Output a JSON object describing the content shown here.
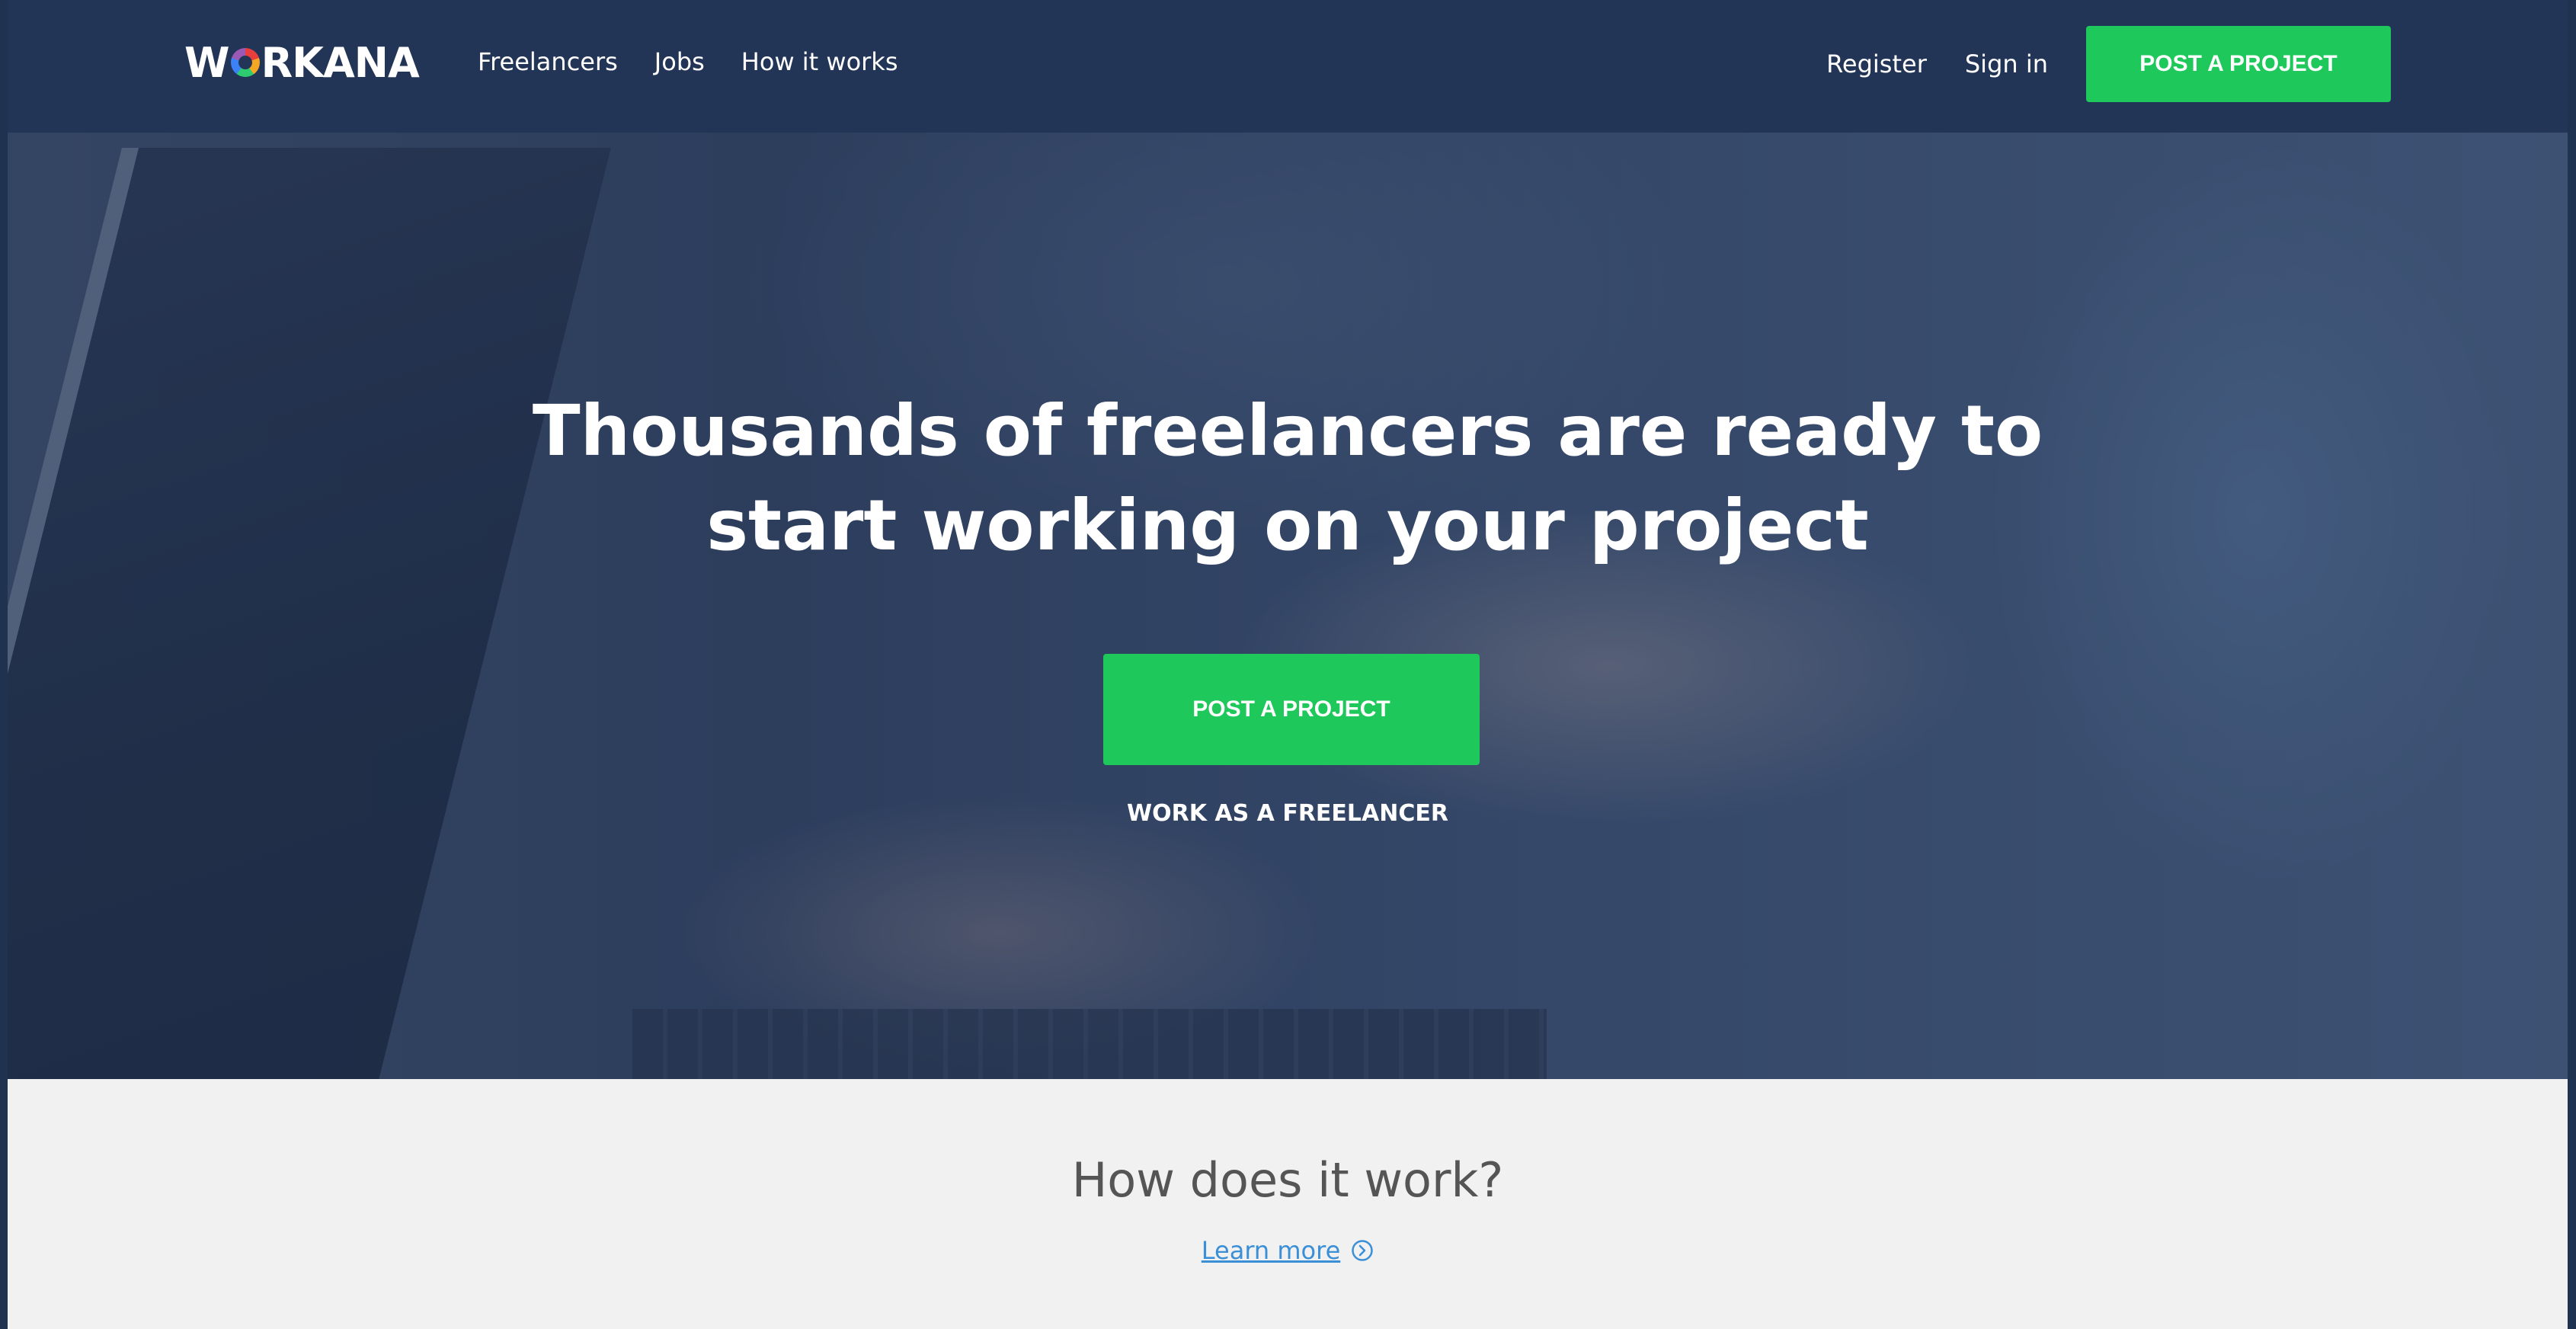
{
  "navbar": {
    "logo_text": "WORKANA",
    "links": [
      {
        "label": "Freelancers"
      },
      {
        "label": "Jobs"
      },
      {
        "label": "How it works"
      }
    ],
    "register_label": "Register",
    "signin_label": "Sign in",
    "cta_label": "POST A PROJECT"
  },
  "hero": {
    "title_line1": "Thousands of freelancers are ready to",
    "title_line2": "start working on your project",
    "cta_label": "POST A PROJECT",
    "secondary_label": "WORK AS A FREELANCER"
  },
  "how": {
    "title": "How does it work?",
    "learn_more_label": "Learn more",
    "learn_more_icon": "chevron-right-circle-icon"
  },
  "colors": {
    "navbar_bg": "#233557",
    "accent_green": "#1ec85a",
    "link_blue": "#3a8fd6",
    "section_bg": "#f1f1f1"
  }
}
